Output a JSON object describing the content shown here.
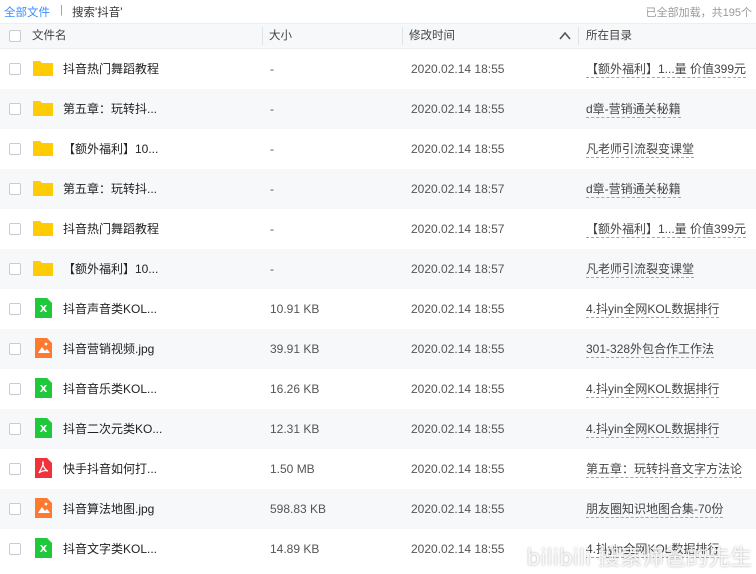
{
  "breadcrumb": {
    "root": "全部文件",
    "separator": "|",
    "current": "搜索'抖音'"
  },
  "status": "已全部加载，共195个",
  "columns": {
    "name": "文件名",
    "size": "大小",
    "modified": "修改时间",
    "directory": "所在目录"
  },
  "sort_icon": "chevron-up-icon",
  "colors": {
    "folder": "#ffcb05",
    "excel": "#1fc93b",
    "image": "#ff7a2e",
    "pdf": "#f0323c",
    "link": "#3b8cff"
  },
  "rows": [
    {
      "type": "folder",
      "name": "抖音热门舞蹈教程",
      "size": "-",
      "modified": "2020.02.14 18:55",
      "directory": "【额外福利】1...量 价值399元"
    },
    {
      "type": "folder",
      "name": "第五章：玩转抖...",
      "size": "-",
      "modified": "2020.02.14 18:55",
      "directory": "d章-营销通关秘籍"
    },
    {
      "type": "folder",
      "name": "【额外福利】10...",
      "size": "-",
      "modified": "2020.02.14 18:55",
      "directory": "凡老师引流裂变课堂"
    },
    {
      "type": "folder",
      "name": "第五章：玩转抖...",
      "size": "-",
      "modified": "2020.02.14 18:57",
      "directory": "d章-营销通关秘籍"
    },
    {
      "type": "folder",
      "name": "抖音热门舞蹈教程",
      "size": "-",
      "modified": "2020.02.14 18:57",
      "directory": "【额外福利】1...量 价值399元"
    },
    {
      "type": "folder",
      "name": "【额外福利】10...",
      "size": "-",
      "modified": "2020.02.14 18:57",
      "directory": "凡老师引流裂变课堂"
    },
    {
      "type": "excel",
      "name": "抖音声音类KOL...",
      "size": "10.91 KB",
      "modified": "2020.02.14 18:55",
      "directory": "4.抖yin全网KOL数据排行"
    },
    {
      "type": "image",
      "name": "抖音营销视频.jpg",
      "size": "39.91 KB",
      "modified": "2020.02.14 18:55",
      "directory": "301-328外包合作工作法"
    },
    {
      "type": "excel",
      "name": "抖音音乐类KOL...",
      "size": "16.26 KB",
      "modified": "2020.02.14 18:55",
      "directory": "4.抖yin全网KOL数据排行"
    },
    {
      "type": "excel",
      "name": "抖音二次元类KO...",
      "size": "12.31 KB",
      "modified": "2020.02.14 18:55",
      "directory": "4.抖yin全网KOL数据排行"
    },
    {
      "type": "pdf",
      "name": "快手抖音如何打...",
      "size": "1.50 MB",
      "modified": "2020.02.14 18:55",
      "directory": "第五章：玩转抖音文字方法论"
    },
    {
      "type": "image",
      "name": "抖音算法地图.jpg",
      "size": "598.83 KB",
      "modified": "2020.02.14 18:55",
      "directory": "朋友圈知识地图合集-70份"
    },
    {
      "type": "excel",
      "name": "抖音文字类KOL...",
      "size": "14.89 KB",
      "modified": "2020.02.14 18:55",
      "directory": "4.抖yin全网KOL数据排行"
    }
  ],
  "watermark": "bilibili 搜索师爸的先生"
}
